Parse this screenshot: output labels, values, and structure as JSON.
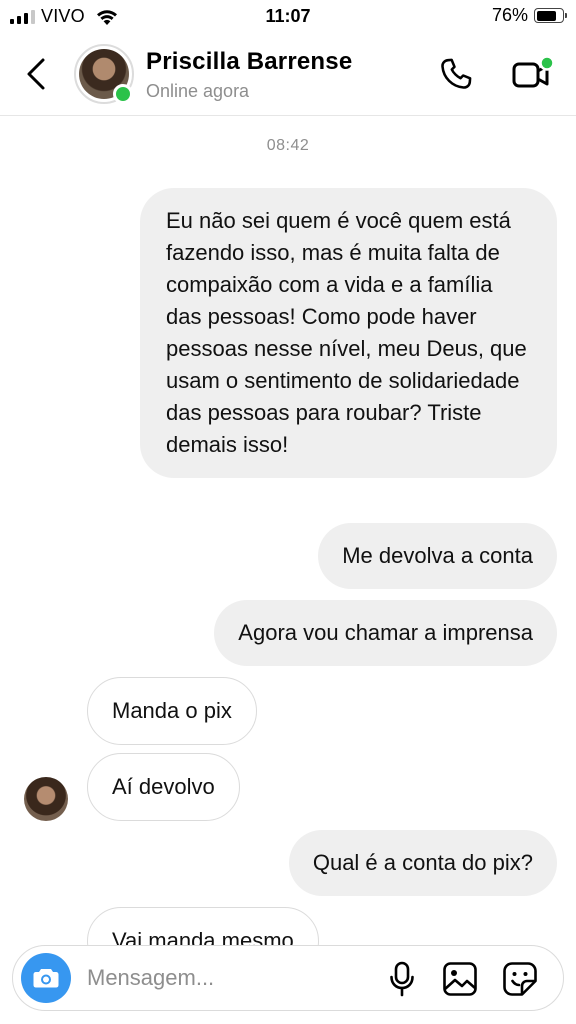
{
  "status_bar": {
    "carrier": "VIVO",
    "time": "11:07",
    "battery_percent": "76%",
    "battery_level": 0.76
  },
  "header": {
    "contact_name": "Priscilla Barrense",
    "contact_status": "Online agora"
  },
  "chat": {
    "timestamp": "08:42",
    "messages": [
      {
        "direction": "sent",
        "text": "Eu não sei quem é você quem está fazendo isso, mas é muita falta de compaixão com a vida e a família das pessoas! Como pode haver pessoas nesse nível, meu Deus, que usam o sentimento de solidariedade das pessoas para roubar? Triste demais isso!"
      },
      {
        "direction": "sent",
        "text": "Me devolva a conta"
      },
      {
        "direction": "sent",
        "text": "Agora vou chamar a imprensa"
      },
      {
        "direction": "received",
        "text": "Manda o pix"
      },
      {
        "direction": "received",
        "text": "Aí devolvo"
      },
      {
        "direction": "sent",
        "text": "Qual é a conta do pix?"
      },
      {
        "direction": "received",
        "text": "Vai manda mesmo"
      }
    ]
  },
  "composer": {
    "placeholder": "Mensagem..."
  },
  "colors": {
    "online_green": "#2bc24a",
    "camera_blue": "#3797f0",
    "sent_bubble": "#efefef",
    "muted_text": "#8e8e8e"
  },
  "icons": [
    "back-chevron-icon",
    "phone-icon",
    "video-camera-icon",
    "camera-icon",
    "microphone-icon",
    "gallery-icon",
    "sticker-icon"
  ]
}
